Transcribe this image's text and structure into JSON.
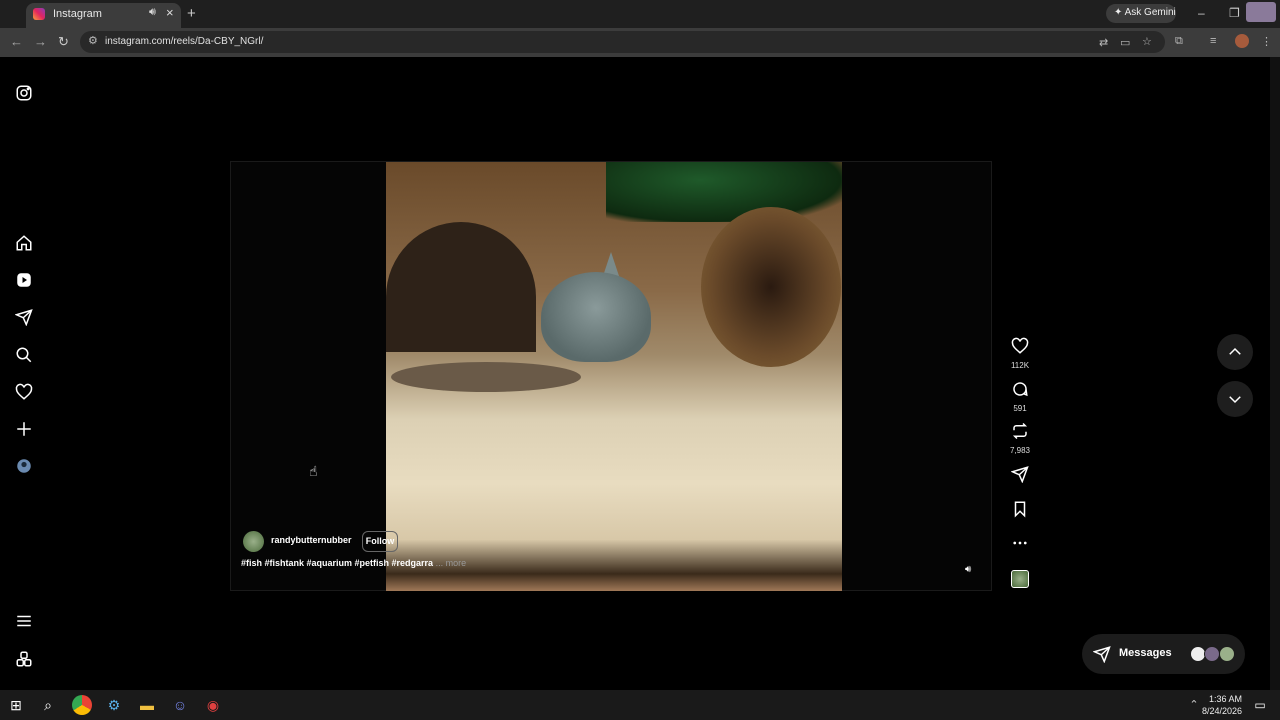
{
  "browser": {
    "tab_title": "Instagram",
    "url": "instagram.com/reels/Da-CBY_NGrl/",
    "ask_gemini": "Ask Gemini"
  },
  "reel": {
    "author": "randybutternubber",
    "follow_label": "Follow",
    "caption": "#fish #fishtank #aquarium #petfish #redgarra",
    "more_label": "... more"
  },
  "actions": {
    "likes": "112K",
    "comments": "591",
    "reposts": "7,983"
  },
  "messages": {
    "label": "Messages"
  },
  "taskbar": {
    "time": "1:36 AM",
    "date": "8/24/2026"
  },
  "colors": {
    "accent": "#ffffff",
    "background": "#000000",
    "panel": "#1c1c1c"
  }
}
